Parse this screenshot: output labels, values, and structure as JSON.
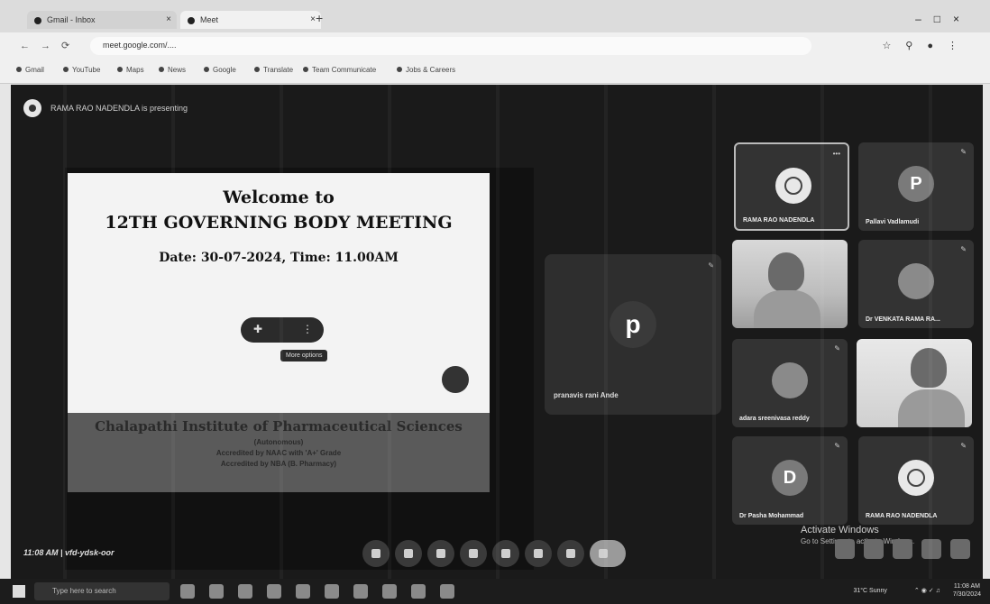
{
  "browser": {
    "tab1_label": "Gmail - Inbox",
    "tab2_label": "Meet",
    "address": "meet.google.com/....",
    "bookmarks": [
      "Gmail",
      "YouTube",
      "Maps",
      "News",
      "Google",
      "Translate",
      "Team Communicate",
      "Jobs & Careers"
    ]
  },
  "meet": {
    "presenting_label": "RAMA RAO NADENDLA is presenting",
    "slide": {
      "welcome": "Welcome to",
      "meeting": "12TH GOVERNING BODY MEETING",
      "date": "Date:  30-07-2024, Time: 11.00AM",
      "tooltip": "More options",
      "institute": "Chalapathi Institute of Pharmaceutical Sciences",
      "sub1": "(Autonomous)",
      "sub2": "Accredited by NAAC with 'A+' Grade",
      "sub3": "Accredited by NBA (B. Pharmacy)"
    },
    "big_tile": {
      "initial": "p",
      "name": "pranavis rani Ande"
    },
    "tiles": [
      {
        "name": "RAMA RAO NADENDLA",
        "type": "logo"
      },
      {
        "name": "Pallavi Vadlamudi",
        "type": "letter",
        "initial": "P"
      },
      {
        "name": "",
        "type": "video"
      },
      {
        "name": "Dr VENKATA RAMA RA...",
        "type": "photo"
      },
      {
        "name": "adara sreenivasa reddy",
        "type": "photo"
      },
      {
        "name": "",
        "type": "video2"
      },
      {
        "name": "Dr Pasha Mohammad",
        "type": "letter",
        "initial": "D"
      },
      {
        "name": "RAMA RAO NADENDLA",
        "type": "logo"
      }
    ],
    "activate_title": "Activate Windows",
    "activate_sub": "Go to Settings to activate Windows.",
    "time_code": "11:08 AM  |  vfd-ydsk-oor"
  },
  "taskbar": {
    "search_placeholder": "Type here to search",
    "weather": "31°C Sunny",
    "time": "11:08 AM",
    "date": "7/30/2024"
  }
}
